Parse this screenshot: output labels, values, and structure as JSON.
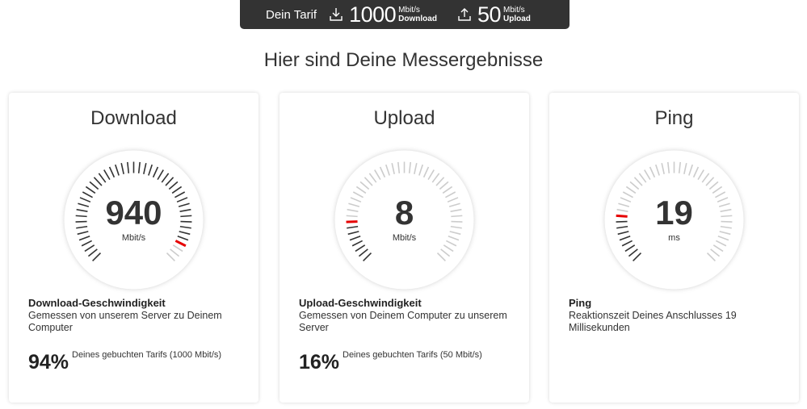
{
  "tariff": {
    "label": "Dein Tarif",
    "download": {
      "value": "1000",
      "unit": "Mbit/s",
      "direction": "Download",
      "icon": "download-icon"
    },
    "upload": {
      "value": "50",
      "unit": "Mbit/s",
      "direction": "Upload",
      "icon": "upload-icon"
    }
  },
  "page_title": "Hier sind Deine Messergebnisse",
  "colors": {
    "accent": "#e60000",
    "dark": "#333333",
    "tick": "#333333",
    "tick_light": "#cccccc"
  },
  "cards": [
    {
      "title": "Download",
      "value": "940",
      "unit": "Mbit/s",
      "gauge_level": 0.94,
      "metric_title": "Download-Geschwindigkeit",
      "metric_desc": "Gemessen von unserem Server zu Deinem Computer",
      "percent": "94%",
      "percent_label": "Deines gebuchten Tarifs (1000 Mbit/s)"
    },
    {
      "title": "Upload",
      "value": "8",
      "unit": "Mbit/s",
      "gauge_level": 0.16,
      "metric_title": "Upload-Geschwindigkeit",
      "metric_desc": "Gemessen von Deinem Computer zu unserem Server",
      "percent": "16%",
      "percent_label": "Deines gebuchten Tarifs (50 Mbit/s)"
    },
    {
      "title": "Ping",
      "value": "19",
      "unit": "ms",
      "gauge_level": 0.19,
      "metric_title": "Ping",
      "metric_desc": "Reaktionszeit Deines Anschlusses 19 Millisekunden",
      "percent": "",
      "percent_label": ""
    }
  ]
}
